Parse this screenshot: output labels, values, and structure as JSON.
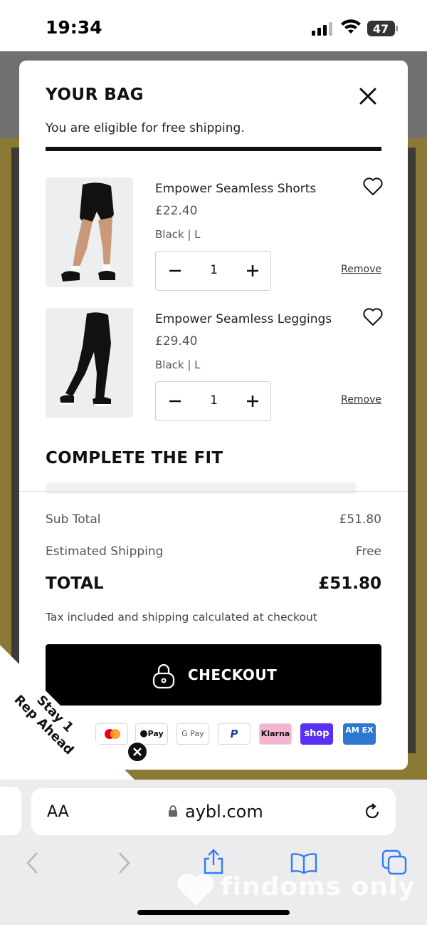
{
  "status_bar": {
    "time": "19:34",
    "battery": "47"
  },
  "bag": {
    "title": "YOUR BAG",
    "shipping_message": "You are eligible for free shipping.",
    "free_shipping_progress": 1.0,
    "items": [
      {
        "name": "Empower Seamless Shorts",
        "price": "£22.40",
        "variant": "Black | L",
        "quantity": "1",
        "remove_label": "Remove"
      },
      {
        "name": "Empower Seamless Leggings",
        "price": "£29.40",
        "variant": "Black | L",
        "quantity": "1",
        "remove_label": "Remove"
      }
    ],
    "complete_fit_title": "COMPLETE THE FIT"
  },
  "summary": {
    "subtotal_label": "Sub Total",
    "subtotal_value": "£51.80",
    "shipping_label": "Estimated Shipping",
    "shipping_value": "Free",
    "total_label": "TOTAL",
    "total_value": "£51.80",
    "tax_note": "Tax included and shipping calculated at checkout",
    "checkout_label": "CHECKOUT"
  },
  "payment_methods": [
    {
      "icon": "mastercard-icon"
    },
    {
      "icon": "apple-pay-icon",
      "label": "Pay"
    },
    {
      "icon": "google-pay-icon",
      "label": "G Pay"
    },
    {
      "icon": "paypal-icon",
      "label": "P"
    },
    {
      "icon": "klarna-icon",
      "label": "Klarna"
    },
    {
      "icon": "shop-pay-icon",
      "label": "shop"
    },
    {
      "icon": "amex-icon",
      "label": "AM EX"
    }
  ],
  "promo": {
    "line1": "Stay 1",
    "line2": "Rep Ahead"
  },
  "browser": {
    "text_size_label": "AA",
    "domain": "aybl.com"
  },
  "watermark": "findoms only",
  "colors": {
    "checkout_bg": "#000000",
    "klarna_pink": "#f5b4d0",
    "shop_purple": "#5a31f4",
    "amex_blue": "#2e77d0"
  }
}
